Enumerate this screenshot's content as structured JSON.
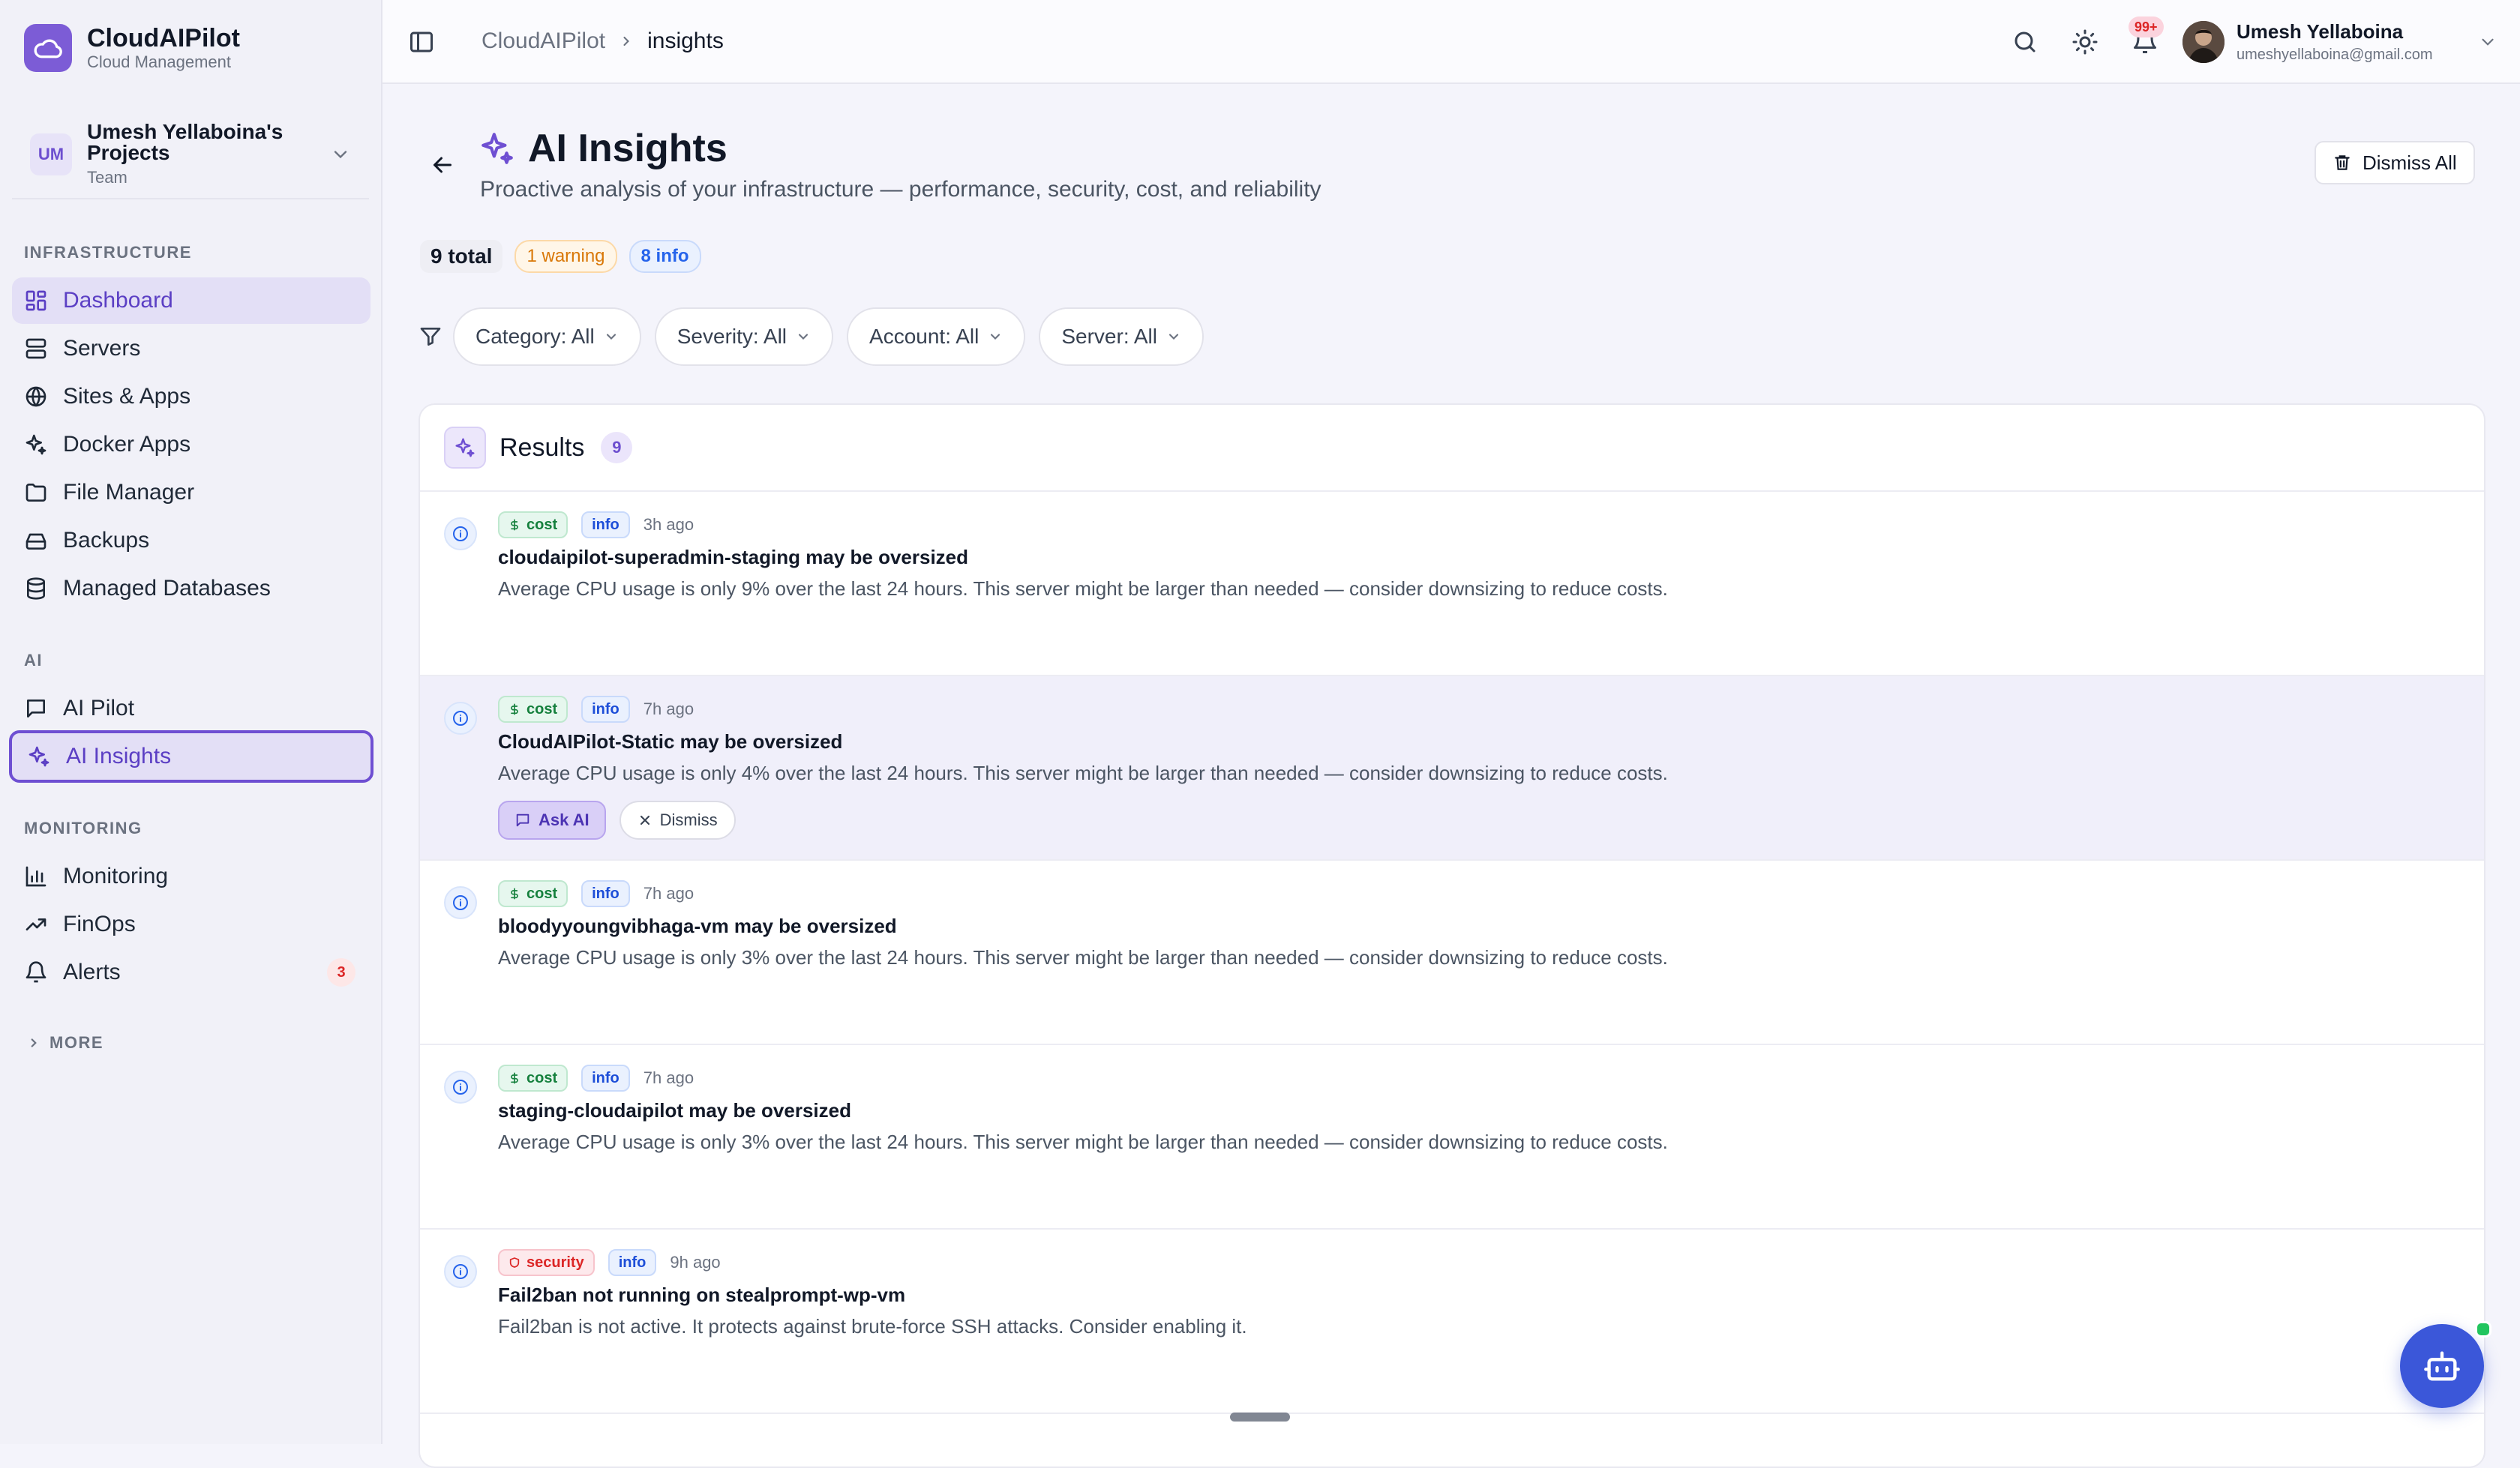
{
  "brand": {
    "name": "CloudAIPilot",
    "subtitle": "Cloud Management"
  },
  "project": {
    "initials": "UM",
    "name_line1": "Umesh Yellaboina's",
    "name_line2": "Projects",
    "role": "Team"
  },
  "sidebar": {
    "sections": [
      {
        "label": "INFRASTRUCTURE",
        "items": [
          {
            "label": "Dashboard",
            "icon": "dashboard-icon"
          },
          {
            "label": "Servers",
            "icon": "server-icon"
          },
          {
            "label": "Sites & Apps",
            "icon": "globe-icon"
          },
          {
            "label": "Docker Apps",
            "icon": "sparkle-icon"
          },
          {
            "label": "File Manager",
            "icon": "folder-icon"
          },
          {
            "label": "Backups",
            "icon": "drive-icon"
          },
          {
            "label": "Managed Databases",
            "icon": "database-icon"
          }
        ]
      },
      {
        "label": "AI",
        "items": [
          {
            "label": "AI Pilot",
            "icon": "chat-icon"
          },
          {
            "label": "AI Insights",
            "icon": "sparkle-icon"
          }
        ]
      },
      {
        "label": "MONITORING",
        "items": [
          {
            "label": "Monitoring",
            "icon": "bar-chart-icon"
          },
          {
            "label": "FinOps",
            "icon": "trend-icon"
          },
          {
            "label": "Alerts",
            "icon": "bell-icon",
            "badge": "3"
          }
        ]
      }
    ],
    "more_label": "MORE"
  },
  "topbar": {
    "breadcrumb": [
      "CloudAIPilot",
      "insights"
    ],
    "notifications_badge": "99+",
    "user": {
      "name": "Umesh Yellaboina",
      "email": "umeshyellaboina@gmail.com"
    }
  },
  "page": {
    "title": "AI Insights",
    "subtitle": "Proactive analysis of your infrastructure — performance, security, cost, and reliability",
    "dismiss_all_label": "Dismiss All",
    "stats": {
      "total": "9 total",
      "warning": "1 warning",
      "info": "8 info"
    },
    "filters": [
      "Category: All",
      "Severity: All",
      "Account: All",
      "Server: All"
    ]
  },
  "results": {
    "title": "Results",
    "count": "9",
    "items": [
      {
        "category": "cost",
        "severity": "info",
        "time": "3h ago",
        "title": "cloudaipilot-superadmin-staging may be oversized",
        "description": "Average CPU usage is only 9% over the last 24 hours. This server might be larger than needed — consider downsizing to reduce costs."
      },
      {
        "category": "cost",
        "severity": "info",
        "time": "7h ago",
        "title": "CloudAIPilot-Static may be oversized",
        "description": "Average CPU usage is only 4% over the last 24 hours. This server might be larger than needed — consider downsizing to reduce costs.",
        "actions": {
          "ask_ai": "Ask AI",
          "dismiss": "Dismiss"
        }
      },
      {
        "category": "cost",
        "severity": "info",
        "time": "7h ago",
        "title": "bloodyyoungvibhaga-vm may be oversized",
        "description": "Average CPU usage is only 3% over the last 24 hours. This server might be larger than needed — consider downsizing to reduce costs."
      },
      {
        "category": "cost",
        "severity": "info",
        "time": "7h ago",
        "title": "staging-cloudaipilot may be oversized",
        "description": "Average CPU usage is only 3% over the last 24 hours. This server might be larger than needed — consider downsizing to reduce costs."
      },
      {
        "category": "security",
        "severity": "info",
        "time": "9h ago",
        "title": "Fail2ban not running on stealprompt-wp-vm",
        "description": "Fail2ban is not active. It protects against brute-force SSH attacks. Consider enabling it."
      }
    ]
  },
  "colors": {
    "accent": "#6e4fd2",
    "fab": "#3b57d9",
    "cost": "#15803d",
    "security": "#dc2626",
    "info": "#1d4ed8",
    "warning": "#d97706"
  }
}
